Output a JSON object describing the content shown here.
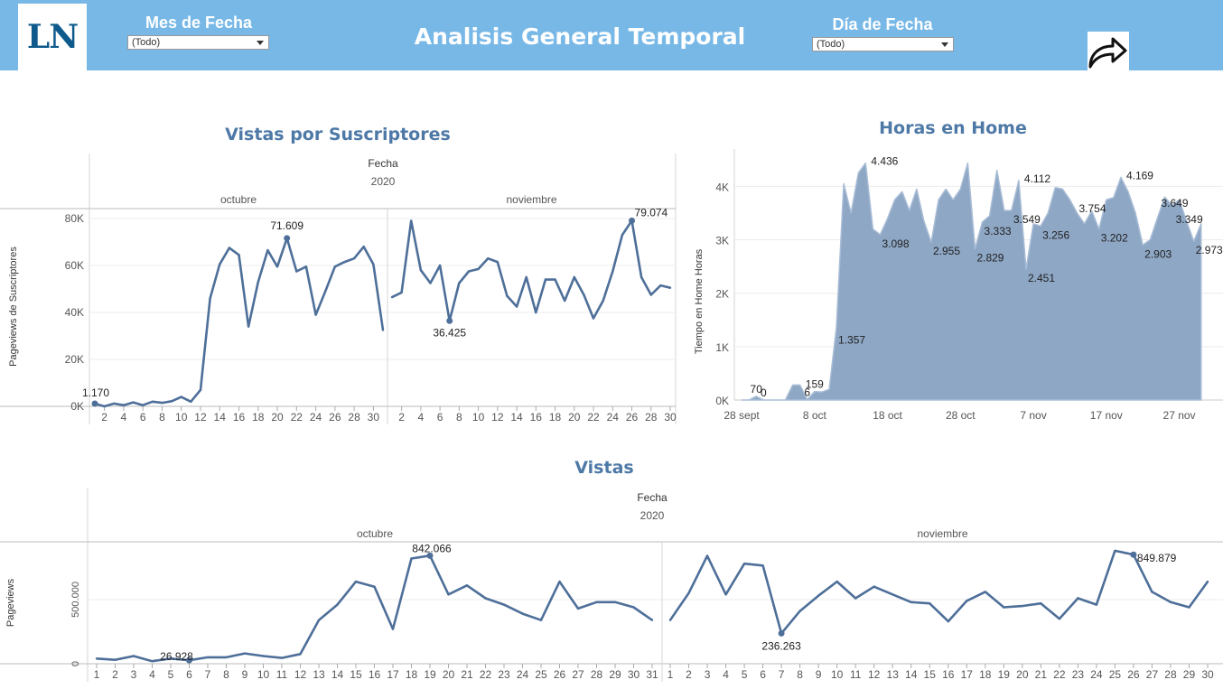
{
  "header": {
    "logo_text": "LN",
    "title": "Analisis General Temporal",
    "month_filter_label": "Mes de Fecha",
    "month_filter_value": "(Todo)",
    "day_filter_label": "Día de Fecha",
    "day_filter_value": "(Todo)",
    "share_icon": "share-arrow-icon"
  },
  "colors": {
    "header_bg": "#78b8e7",
    "title_color": "#4e79a7",
    "line_color": "#4e6f99",
    "area_fill": "#8ea7c5",
    "area_stroke": "#a9bdd6"
  },
  "chart_data": [
    {
      "id": "subs",
      "type": "line",
      "title": "Vistas por Suscriptores",
      "column_header": "Fecha",
      "column_year": "2020",
      "panels": [
        {
          "name": "octubre",
          "x": [
            1,
            2,
            3,
            4,
            5,
            6,
            7,
            8,
            9,
            10,
            11,
            12,
            13,
            14,
            15,
            16,
            17,
            18,
            19,
            20,
            21,
            22,
            23,
            24,
            25,
            26,
            27,
            28,
            29,
            30,
            31
          ],
          "values": [
            1170,
            0,
            1200,
            500,
            1700,
            500,
            2000,
            1500,
            2200,
            4000,
            2000,
            7000,
            46000,
            60500,
            67500,
            64500,
            34000,
            53000,
            66500,
            59500,
            71609,
            57500,
            59500,
            39000,
            49000,
            59500,
            61500,
            63000,
            68000,
            60500,
            32500
          ],
          "ticks": [
            2,
            4,
            6,
            8,
            10,
            12,
            14,
            16,
            18,
            20,
            22,
            24,
            26,
            28,
            30
          ]
        },
        {
          "name": "noviembre",
          "x": [
            1,
            2,
            3,
            4,
            5,
            6,
            7,
            8,
            9,
            10,
            11,
            12,
            13,
            14,
            15,
            16,
            17,
            18,
            19,
            20,
            21,
            22,
            23,
            24,
            25,
            26,
            27,
            28,
            29,
            30
          ],
          "values": [
            46500,
            48500,
            79000,
            58000,
            52500,
            60000,
            36425,
            52500,
            57500,
            58500,
            63000,
            61500,
            47000,
            42500,
            55000,
            40000,
            54000,
            54000,
            45000,
            55000,
            47500,
            37500,
            45000,
            57500,
            73000,
            79074,
            55000,
            47500,
            51500,
            50500
          ],
          "ticks": [
            2,
            4,
            6,
            8,
            10,
            12,
            14,
            16,
            18,
            20,
            22,
            24,
            26,
            28,
            30
          ]
        }
      ],
      "ylabel": "Pageviews de Suscriptores",
      "yticks": [
        "0K",
        "20K",
        "40K",
        "60K",
        "80K"
      ],
      "ylim": [
        0,
        85000
      ],
      "annotations": [
        {
          "panel": 0,
          "x": 1,
          "value": 1170,
          "label": "1.170"
        },
        {
          "panel": 0,
          "x": 21,
          "value": 71609,
          "label": "71.609"
        },
        {
          "panel": 1,
          "x": 7,
          "value": 36425,
          "label": "36.425"
        },
        {
          "panel": 1,
          "x": 26,
          "value": 79074,
          "label": "79.074"
        }
      ]
    },
    {
      "id": "horas",
      "type": "area",
      "title": "Horas en Home",
      "ylabel": "Tiempo en Home Horas",
      "yticks": [
        "0K",
        "1K",
        "2K",
        "3K",
        "4K"
      ],
      "ylim": [
        0,
        4700
      ],
      "xlim": [
        "2020-09-27",
        "2020-12-03"
      ],
      "xticks": [
        "28 sept",
        "8 oct",
        "18 oct",
        "28 oct",
        "7 nov",
        "17 nov",
        "27 nov"
      ],
      "x": [
        "2020-09-28",
        "2020-09-29",
        "2020-09-30",
        "2020-10-01",
        "2020-10-02",
        "2020-10-03",
        "2020-10-04",
        "2020-10-05",
        "2020-10-06",
        "2020-10-07",
        "2020-10-08",
        "2020-10-09",
        "2020-10-10",
        "2020-10-11",
        "2020-10-12",
        "2020-10-13",
        "2020-10-14",
        "2020-10-15",
        "2020-10-16",
        "2020-10-17",
        "2020-10-18",
        "2020-10-19",
        "2020-10-20",
        "2020-10-21",
        "2020-10-22",
        "2020-10-23",
        "2020-10-24",
        "2020-10-25",
        "2020-10-26",
        "2020-10-27",
        "2020-10-28",
        "2020-10-29",
        "2020-10-30",
        "2020-10-31",
        "2020-11-01",
        "2020-11-02",
        "2020-11-03",
        "2020-11-04",
        "2020-11-05",
        "2020-11-06",
        "2020-11-07",
        "2020-11-08",
        "2020-11-09",
        "2020-11-10",
        "2020-11-11",
        "2020-11-12",
        "2020-11-13",
        "2020-11-14",
        "2020-11-15",
        "2020-11-16",
        "2020-11-17",
        "2020-11-18",
        "2020-11-19",
        "2020-11-20",
        "2020-11-21",
        "2020-11-22",
        "2020-11-23",
        "2020-11-24",
        "2020-11-25",
        "2020-11-26",
        "2020-11-27",
        "2020-11-28",
        "2020-11-29",
        "2020-11-30"
      ],
      "values": [
        0,
        0,
        70,
        0,
        0,
        0,
        0,
        280,
        280,
        6,
        159,
        150,
        200,
        1357,
        4050,
        3500,
        4250,
        4436,
        3200,
        3098,
        3400,
        3750,
        3900,
        3550,
        3950,
        3350,
        2955,
        3750,
        3950,
        3750,
        3950,
        4436,
        2829,
        3333,
        3450,
        4300,
        3550,
        3549,
        4112,
        2451,
        3300,
        3256,
        3500,
        3980,
        3950,
        3754,
        3500,
        3300,
        3540,
        3202,
        3750,
        3790,
        4169,
        3900,
        3500,
        2903,
        3000,
        3400,
        3800,
        3649,
        3750,
        3349,
        2973,
        3300
      ],
      "labels": [
        {
          "x": "2020-09-30",
          "value": 70,
          "label": "70"
        },
        {
          "x": "2020-10-01",
          "value": 0,
          "label": "0"
        },
        {
          "x": "2020-10-07",
          "value": 6,
          "label": "6"
        },
        {
          "x": "2020-10-08",
          "value": 159,
          "label": "159"
        },
        {
          "x": "2020-10-11",
          "value": 1357,
          "label": "1.357"
        },
        {
          "x": "2020-10-15",
          "value": 4436,
          "label": "4.436"
        },
        {
          "x": "2020-10-17",
          "value": 3098,
          "label": "3.098"
        },
        {
          "x": "2020-10-24",
          "value": 2955,
          "label": "2.955"
        },
        {
          "x": "2020-10-30",
          "value": 2829,
          "label": "2.829"
        },
        {
          "x": "2020-10-31",
          "value": 3333,
          "label": "3.333"
        },
        {
          "x": "2020-11-04",
          "value": 3549,
          "label": "3.549"
        },
        {
          "x": "2020-11-05",
          "value": 4112,
          "label": "4.112"
        },
        {
          "x": "2020-11-06",
          "value": 2451,
          "label": "2.451"
        },
        {
          "x": "2020-11-08",
          "value": 3256,
          "label": "3.256"
        },
        {
          "x": "2020-11-13",
          "value": 3754,
          "label": "3.754"
        },
        {
          "x": "2020-11-16",
          "value": 3202,
          "label": "3.202"
        },
        {
          "x": "2020-11-19",
          "value": 4169,
          "label": "4.169"
        },
        {
          "x": "2020-11-22",
          "value": 2903,
          "label": "2.903"
        },
        {
          "x": "2020-11-26",
          "value": 3649,
          "label": "3.649"
        },
        {
          "x": "2020-11-28",
          "value": 3349,
          "label": "3.349"
        },
        {
          "x": "2020-11-29",
          "value": 2973,
          "label": "2.973"
        }
      ]
    },
    {
      "id": "vistas",
      "type": "line",
      "title": "Vistas",
      "column_header": "Fecha",
      "column_year": "2020",
      "panels": [
        {
          "name": "octubre",
          "x": [
            1,
            2,
            3,
            4,
            5,
            6,
            7,
            8,
            9,
            10,
            11,
            12,
            13,
            14,
            15,
            16,
            17,
            18,
            19,
            20,
            21,
            22,
            23,
            24,
            25,
            26,
            27,
            28,
            29,
            30,
            31
          ],
          "values": [
            40000,
            30000,
            60000,
            20000,
            40000,
            26928,
            50000,
            50000,
            80000,
            60000,
            45000,
            75000,
            340000,
            460000,
            640000,
            600000,
            270000,
            820000,
            842066,
            540000,
            610000,
            510000,
            460000,
            390000,
            340000,
            640000,
            430000,
            480000,
            480000,
            440000,
            340000
          ],
          "ticks": [
            1,
            2,
            3,
            4,
            5,
            6,
            7,
            8,
            9,
            10,
            11,
            12,
            13,
            14,
            15,
            16,
            17,
            18,
            19,
            20,
            21,
            22,
            23,
            24,
            25,
            26,
            27,
            28,
            29,
            30,
            31
          ]
        },
        {
          "name": "noviembre",
          "x": [
            1,
            2,
            3,
            4,
            5,
            6,
            7,
            8,
            9,
            10,
            11,
            12,
            13,
            14,
            15,
            16,
            17,
            18,
            19,
            20,
            21,
            22,
            23,
            24,
            25,
            26,
            27,
            28,
            29,
            30
          ],
          "values": [
            340000,
            550000,
            840000,
            540000,
            780000,
            765000,
            236263,
            410000,
            530000,
            640000,
            510000,
            600000,
            540000,
            480000,
            470000,
            330000,
            490000,
            560000,
            440000,
            450000,
            470000,
            350000,
            510000,
            460000,
            880000,
            849879,
            560000,
            480000,
            440000,
            640000
          ],
          "ticks": [
            1,
            2,
            3,
            4,
            5,
            6,
            7,
            8,
            9,
            10,
            11,
            12,
            13,
            14,
            15,
            16,
            17,
            18,
            19,
            20,
            21,
            22,
            23,
            24,
            25,
            26,
            27,
            28,
            29,
            30
          ]
        }
      ],
      "ylabel": "Pageviews",
      "yticks": [
        "0",
        "500.000"
      ],
      "ylim": [
        0,
        950000
      ],
      "annotations": [
        {
          "panel": 0,
          "x": 6,
          "value": 26928,
          "label": "26.928"
        },
        {
          "panel": 0,
          "x": 19,
          "value": 842066,
          "label": "842.066"
        },
        {
          "panel": 1,
          "x": 7,
          "value": 236263,
          "label": "236.263"
        },
        {
          "panel": 1,
          "x": 26,
          "value": 849879,
          "label": "849.879"
        }
      ]
    }
  ]
}
